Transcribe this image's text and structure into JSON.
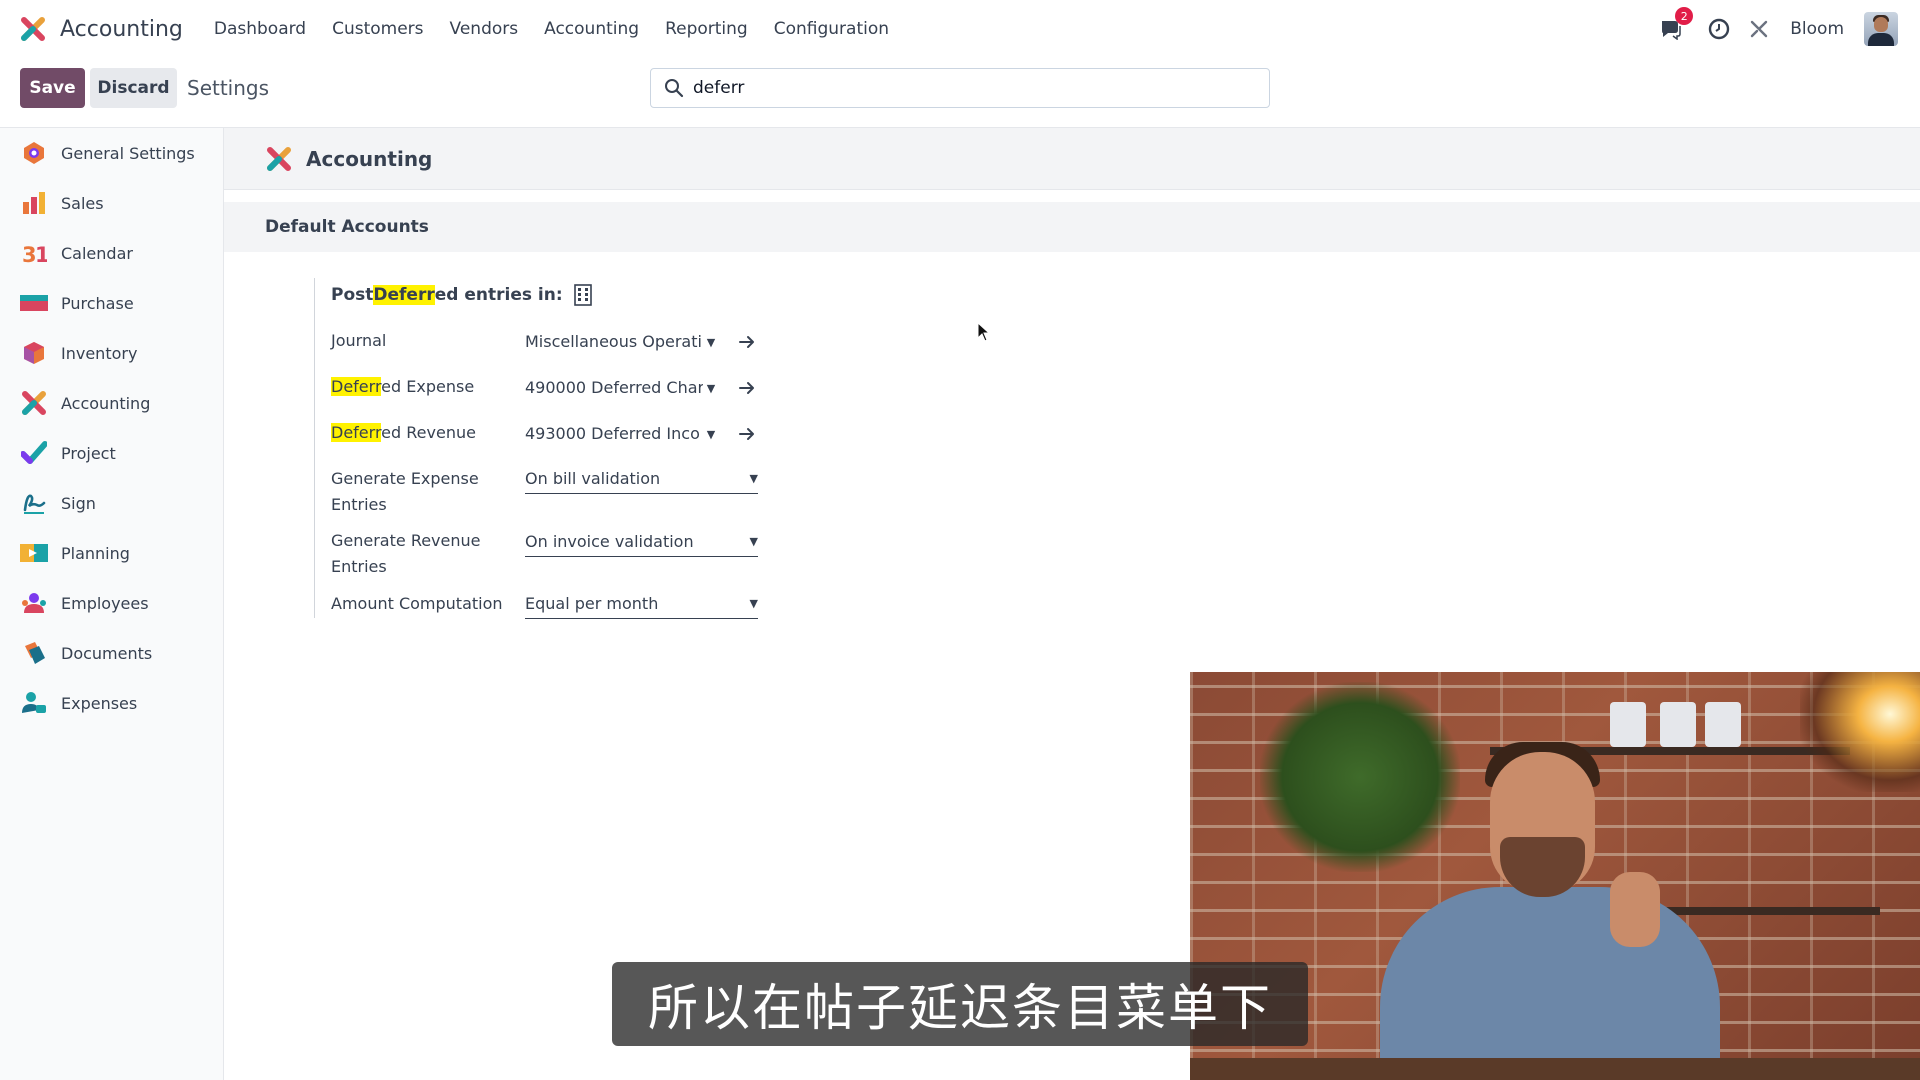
{
  "navbar": {
    "app_name": "Accounting",
    "menu": [
      "Dashboard",
      "Customers",
      "Vendors",
      "Accounting",
      "Reporting",
      "Configuration"
    ],
    "messages_badge": "2",
    "company": "Bloom",
    "icons": [
      "chat-icon",
      "clock-icon",
      "tools-icon"
    ]
  },
  "control_panel": {
    "save_label": "Save",
    "discard_label": "Discard",
    "title": "Settings",
    "search_value": "deferr",
    "colors": {
      "save": "#714b67",
      "discard": "#e7e9ed"
    }
  },
  "sidebar": {
    "items": [
      {
        "label": "General Settings",
        "icon": "general-settings-icon"
      },
      {
        "label": "Sales",
        "icon": "sales-icon"
      },
      {
        "label": "Calendar",
        "icon": "calendar-icon"
      },
      {
        "label": "Purchase",
        "icon": "purchase-icon"
      },
      {
        "label": "Inventory",
        "icon": "inventory-icon"
      },
      {
        "label": "Accounting",
        "icon": "accounting-icon"
      },
      {
        "label": "Project",
        "icon": "project-icon"
      },
      {
        "label": "Sign",
        "icon": "sign-icon"
      },
      {
        "label": "Planning",
        "icon": "planning-icon"
      },
      {
        "label": "Employees",
        "icon": "employees-icon"
      },
      {
        "label": "Documents",
        "icon": "documents-icon"
      },
      {
        "label": "Expenses",
        "icon": "expenses-icon"
      }
    ]
  },
  "main": {
    "app_title": "Accounting",
    "section_title": "Default Accounts",
    "block": {
      "title_pre": "Post ",
      "title_hl": "Deferr",
      "title_post": "ed entries in:",
      "highlight_color": "#fff200",
      "fields": {
        "journal_label": "Journal",
        "journal_value": "Miscellaneous Operati",
        "expense_label_hl": "Deferr",
        "expense_label_rest": "ed Expense",
        "expense_value": "490000 Deferred Char",
        "revenue_label_hl": "Deferr",
        "revenue_label_rest": "ed Revenue",
        "revenue_value": "493000 Deferred Inco",
        "gen_expense_label": "Generate Expense Entries",
        "gen_expense_value": "On bill validation",
        "gen_revenue_label": "Generate Revenue Entries",
        "gen_revenue_value": "On invoice validation",
        "amount_label": "Amount Computation",
        "amount_value": "Equal per month"
      }
    }
  },
  "subtitle": "所以在帖子延迟条目菜单下"
}
